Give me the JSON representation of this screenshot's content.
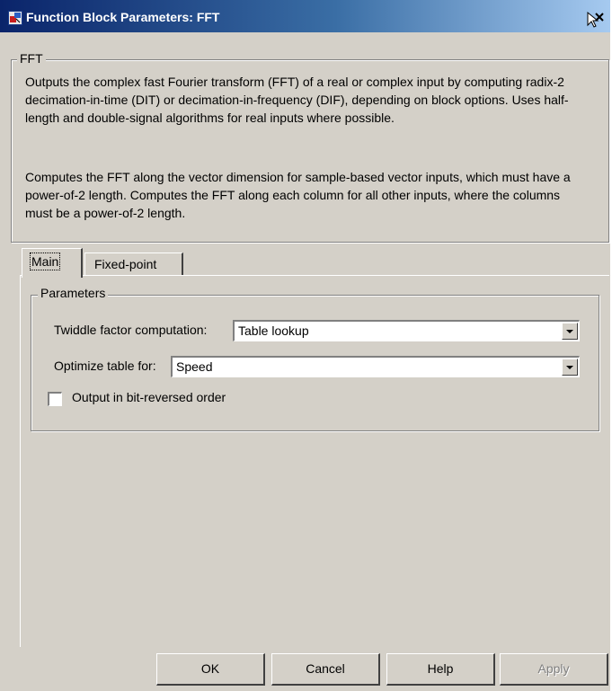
{
  "window": {
    "title": "Function Block Parameters: FFT"
  },
  "block_group": {
    "legend": "FFT",
    "description": [
      "Outputs the complex fast Fourier transform (FFT) of a real or complex input by computing radix-2 decimation-in-time (DIT) or decimation-in-frequency (DIF), depending on block options. Uses half-length and double-signal algorithms for real inputs where possible.",
      "Computes the FFT along the vector dimension for sample-based vector inputs, which must have a power-of-2 length. Computes the FFT along each column for all other inputs, where the columns must be a power-of-2 length."
    ]
  },
  "tabs": [
    {
      "label": "Main",
      "active": true
    },
    {
      "label": "Fixed-point",
      "active": false
    }
  ],
  "parameters": {
    "legend": "Parameters",
    "twiddle": {
      "label": "Twiddle factor computation:",
      "value": "Table lookup"
    },
    "optimize": {
      "label": "Optimize table for:",
      "value": "Speed"
    },
    "bit_reversed": {
      "label": "Output in bit-reversed order",
      "checked": false
    }
  },
  "buttons": {
    "ok": "OK",
    "cancel": "Cancel",
    "help": "Help",
    "apply": "Apply"
  },
  "colors": {
    "titlebar_start": "#0a246a",
    "titlebar_end": "#a6caf0",
    "dialog_face": "#d4d0c8"
  },
  "icons": {
    "app": "simulink-block-icon",
    "close": "close-icon"
  }
}
